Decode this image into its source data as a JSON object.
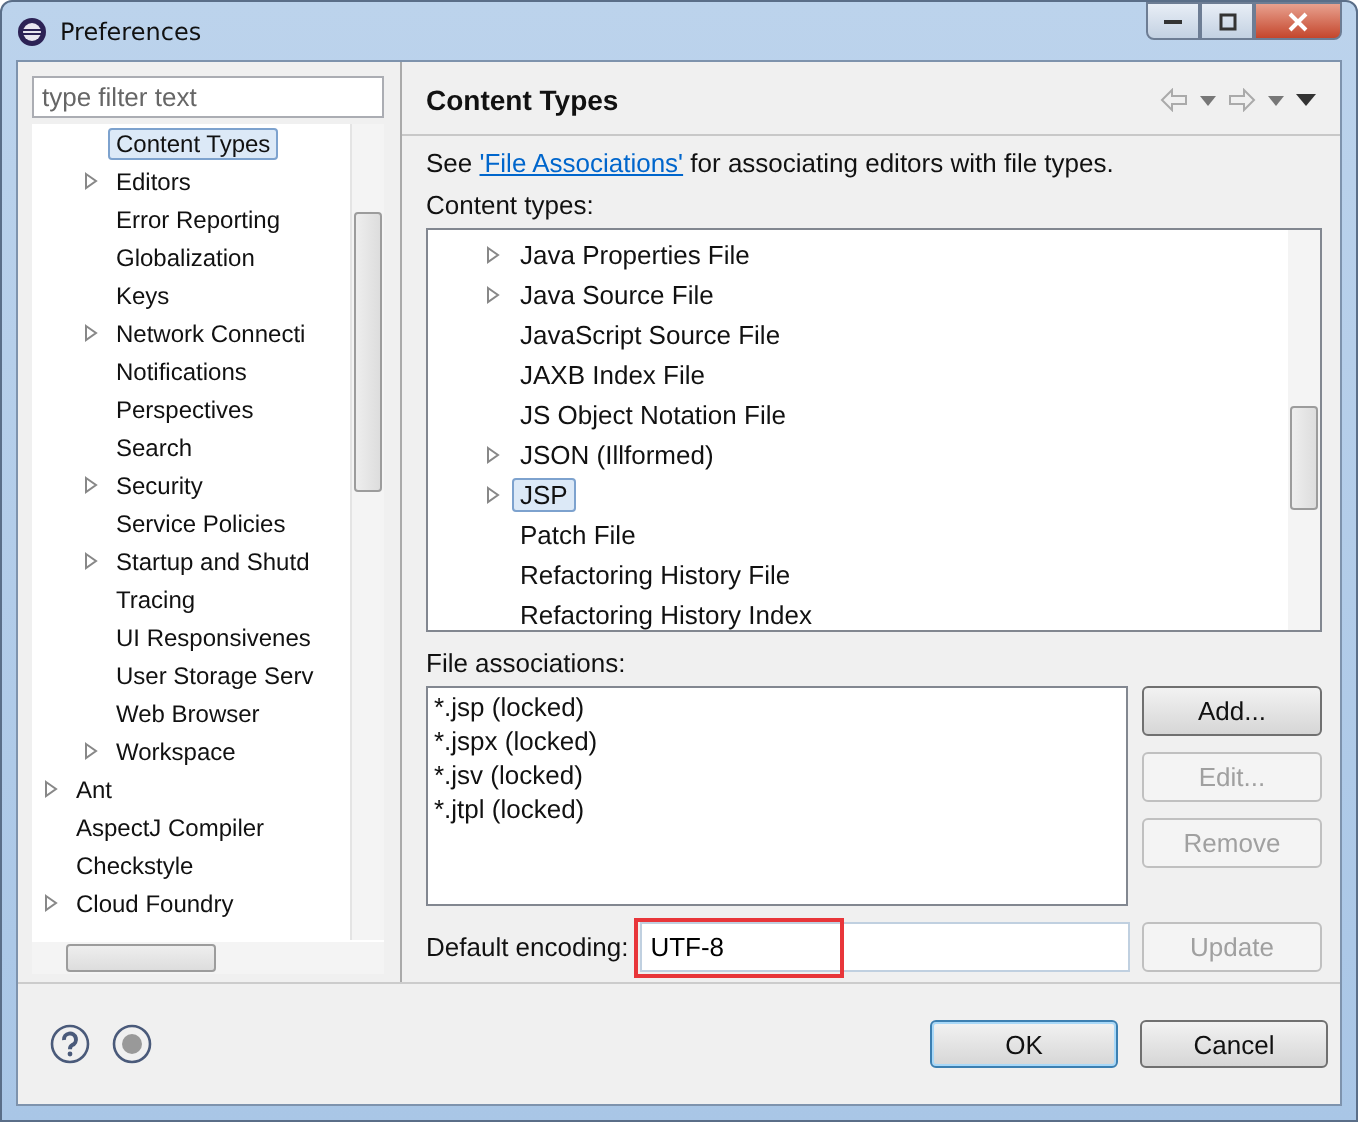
{
  "window": {
    "title": "Preferences"
  },
  "filter": {
    "placeholder": "type filter text"
  },
  "tree": [
    {
      "children": [
        {
          "label": "Content Types",
          "collapsed": false,
          "selected": true
        },
        {
          "label": "Editors",
          "collapsed": true,
          "selected": false
        },
        {
          "label": "Error Reporting",
          "collapsed": false,
          "selected": false
        },
        {
          "label": "Globalization",
          "collapsed": false,
          "selected": false
        },
        {
          "label": "Keys",
          "collapsed": false,
          "selected": false
        },
        {
          "label": "Network Connecti",
          "collapsed": true,
          "selected": false
        },
        {
          "label": "Notifications",
          "collapsed": false,
          "selected": false
        },
        {
          "label": "Perspectives",
          "collapsed": false,
          "selected": false
        },
        {
          "label": "Search",
          "collapsed": false,
          "selected": false
        },
        {
          "label": "Security",
          "collapsed": true,
          "selected": false
        },
        {
          "label": "Service Policies",
          "collapsed": false,
          "selected": false
        },
        {
          "label": "Startup and Shutd",
          "collapsed": true,
          "selected": false
        },
        {
          "label": "Tracing",
          "collapsed": false,
          "selected": false
        },
        {
          "label": "UI Responsivenes",
          "collapsed": false,
          "selected": false
        },
        {
          "label": "User Storage Serv",
          "collapsed": false,
          "selected": false
        },
        {
          "label": "Web Browser",
          "collapsed": false,
          "selected": false
        },
        {
          "label": "Workspace",
          "collapsed": true,
          "selected": false
        }
      ]
    },
    {
      "label": "Ant",
      "collapsed": true,
      "selected": false
    },
    {
      "label": "AspectJ Compiler",
      "collapsed": false,
      "selected": false
    },
    {
      "label": "Checkstyle",
      "collapsed": false,
      "selected": false
    },
    {
      "label": "Cloud Foundry",
      "collapsed": true,
      "selected": false
    }
  ],
  "page": {
    "title": "Content Types",
    "intro_before": "See ",
    "intro_link": "'File Associations'",
    "intro_after": " for associating editors with file types.",
    "content_types_label": "Content types:",
    "content_types": [
      {
        "label": "Java Properties File",
        "collapsed": true,
        "selected": false
      },
      {
        "label": "Java Source File",
        "collapsed": true,
        "selected": false
      },
      {
        "label": "JavaScript Source File",
        "collapsed": false,
        "selected": false
      },
      {
        "label": "JAXB Index File",
        "collapsed": false,
        "selected": false
      },
      {
        "label": "JS Object Notation File",
        "collapsed": false,
        "selected": false
      },
      {
        "label": "JSON (Illformed)",
        "collapsed": true,
        "selected": false
      },
      {
        "label": "JSP",
        "collapsed": true,
        "selected": true
      },
      {
        "label": "Patch File",
        "collapsed": false,
        "selected": false
      },
      {
        "label": "Refactoring History File",
        "collapsed": false,
        "selected": false
      },
      {
        "label": "Refactoring History Index",
        "collapsed": false,
        "selected": false
      }
    ],
    "associations_label": "File associations:",
    "associations": [
      "*.jsp (locked)",
      "*.jspx (locked)",
      "*.jsv (locked)",
      "*.jtpl (locked)"
    ],
    "association_buttons": [
      {
        "label": "Add...",
        "disabled": false
      },
      {
        "label": "Edit...",
        "disabled": true
      },
      {
        "label": "Remove",
        "disabled": true
      }
    ],
    "encoding_label": "Default encoding:",
    "encoding": {
      "value": "UTF-8",
      "highlighted": true
    },
    "update_button": {
      "label": "Update",
      "disabled": true
    }
  },
  "dialog_buttons": [
    {
      "label": "OK",
      "default": true
    },
    {
      "label": "Cancel",
      "default": false
    }
  ]
}
